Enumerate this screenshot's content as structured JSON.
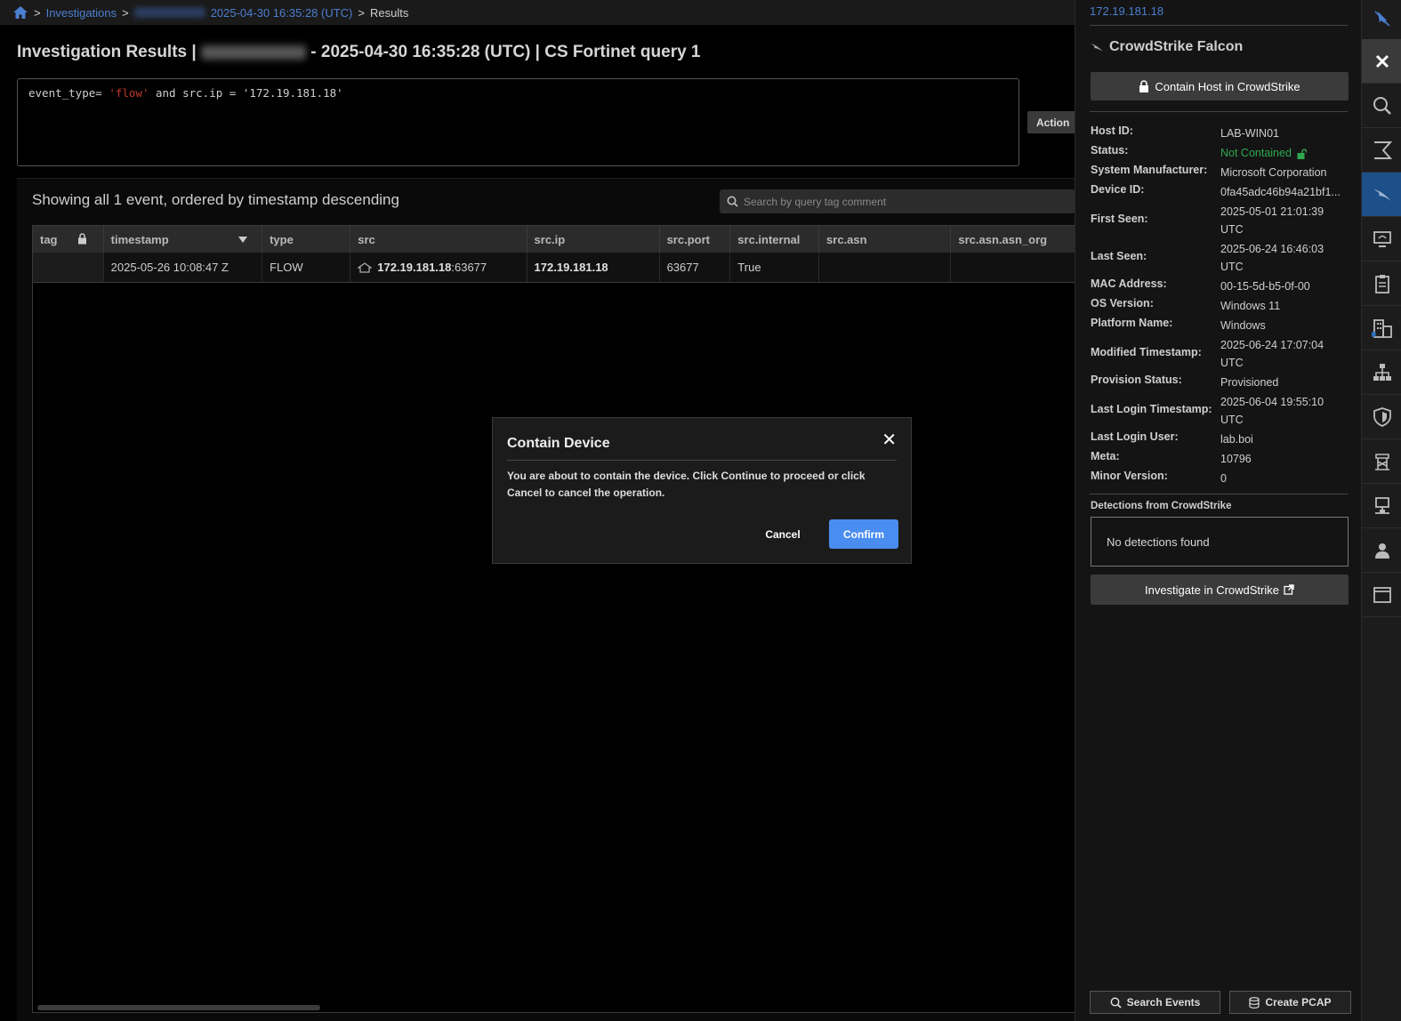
{
  "breadcrumb": {
    "investigations": "Investigations",
    "datetime": "2025-04-30 16:35:28 (UTC)",
    "current": "Results"
  },
  "page_title": {
    "prefix": "Investigation Results |",
    "suffix": "- 2025-04-30 16:35:28 (UTC) | CS Fortinet query 1"
  },
  "query": {
    "part1": "event_type= ",
    "str1": "'flow'",
    "part2": " and src.ip = '172.19.181.18'"
  },
  "actions_label": "Action",
  "results": {
    "summary": "Showing all 1 event, ordered by timestamp descending",
    "search_placeholder": "Search by query tag comment",
    "columns": [
      "tag",
      "timestamp",
      "type",
      "src",
      "src.ip",
      "src.port",
      "src.internal",
      "src.asn",
      "src.asn.asn_org"
    ],
    "rows": [
      {
        "tag": "",
        "timestamp": "2025-05-26 10:08:47 Z",
        "type": "FLOW",
        "src_ip_bold": "172.19.181.18",
        "src_port_suffix": ":63677",
        "src_ip": "172.19.181.18",
        "src_port": "63677",
        "src_internal": "True",
        "src_asn": "",
        "src_asn_org": ""
      }
    ]
  },
  "modal": {
    "title": "Contain Device",
    "close": "✕",
    "body": "You are about to contain the device. Click Continue to proceed or click Cancel to cancel the operation.",
    "cancel": "Cancel",
    "confirm": "Confirm"
  },
  "side_panel": {
    "ip": "172.19.181.18",
    "title": "CrowdStrike Falcon",
    "contain_button": "Contain Host in CrowdStrike",
    "fields": [
      {
        "key": "Host ID:",
        "value": "LAB-WIN01"
      },
      {
        "key": "Status:",
        "value": "Not Contained"
      },
      {
        "key": "System Manufacturer:",
        "value": "Microsoft Corporation"
      },
      {
        "key": "Device ID:",
        "value": "0fa45adc46b94a21bf1..."
      },
      {
        "key": "First Seen:",
        "value": "2025-05-01 21:01:39 UTC"
      },
      {
        "key": "Last Seen:",
        "value": "2025-06-24 16:46:03 UTC"
      },
      {
        "key": "MAC Address:",
        "value": "00-15-5d-b5-0f-00"
      },
      {
        "key": "OS Version:",
        "value": "Windows 11"
      },
      {
        "key": "Platform Name:",
        "value": "Windows"
      },
      {
        "key": "Modified Timestamp:",
        "value": "2025-06-24 17:07:04 UTC"
      },
      {
        "key": "Provision Status:",
        "value": "Provisioned"
      },
      {
        "key": "Last Login Timestamp:",
        "value": "2025-06-04 19:55:10 UTC"
      },
      {
        "key": "Last Login User:",
        "value": "lab.boi"
      },
      {
        "key": "Meta:",
        "value": "10796"
      },
      {
        "key": "Minor Version:",
        "value": "0"
      }
    ],
    "detections_label": "Detections from CrowdStrike",
    "no_detections": "No detections found",
    "investigate_button": "Investigate in CrowdStrike",
    "search_events": "Search Events",
    "create_pcap": "Create PCAP"
  },
  "colors": {
    "accent_blue": "#4a8df0",
    "link_blue": "#4c7fd1",
    "status_green": "#2ea84f",
    "active_rail": "#1d4f88"
  },
  "rail_icons": [
    "pin-icon",
    "close-icon",
    "search-icon",
    "sigma-icon",
    "crowdstrike-falcon-icon",
    "monitor-icon",
    "clipboard-icon",
    "building-icon",
    "network-tree-icon",
    "shield-icon",
    "tower-icon",
    "desktop-network-icon",
    "user-icon",
    "window-icon"
  ]
}
